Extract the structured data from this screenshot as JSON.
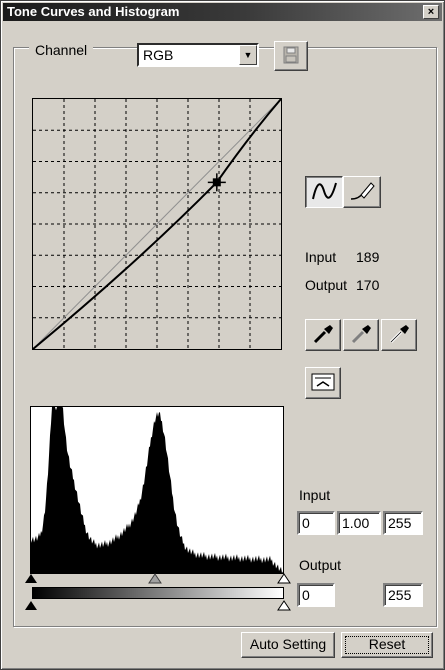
{
  "window": {
    "title": "Tone Curves and Histogram",
    "close_glyph": "×"
  },
  "channel": {
    "label": "Channel",
    "value": "RGB",
    "arrow": "▼"
  },
  "curve": {
    "input_label": "Input",
    "input_value": "189",
    "output_label": "Output",
    "output_value": "170",
    "grid_divisions": 8
  },
  "histogram": {
    "input_label": "Input",
    "input_black": "0",
    "input_gamma": "1.00",
    "input_white": "255",
    "output_label": "Output",
    "output_black": "0",
    "output_white": "255"
  },
  "buttons": {
    "auto_setting": "Auto Setting",
    "reset": "Reset"
  },
  "colors": {
    "face": "#d4d0c8",
    "title_dark": "#1a1a1a",
    "title_light": "#6e6e6e"
  },
  "icons": {
    "save": "save-curve-icon",
    "curve_tool": "curve-mode-icon",
    "pencil_tool": "freehand-pencil-icon",
    "black_dropper": "black-point-dropper-icon",
    "gray_dropper": "gray-point-dropper-icon",
    "white_dropper": "white-point-dropper-icon",
    "reset_curve": "reset-curve-icon"
  }
}
